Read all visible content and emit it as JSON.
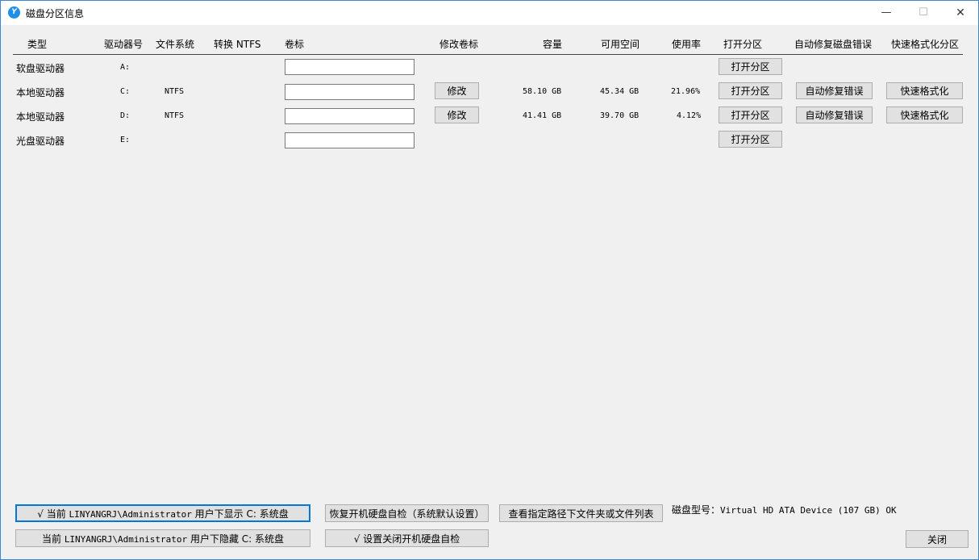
{
  "window": {
    "title": "磁盘分区信息",
    "app_icon_text": "Y",
    "min_glyph": "—",
    "max_glyph": "☐",
    "close_glyph": "✕"
  },
  "headers": {
    "type": "类型",
    "drive_letter": "驱动器号",
    "filesystem": "文件系统",
    "convert_ntfs": "转换 NTFS",
    "volume_label": "卷标",
    "modify_label": "修改卷标",
    "capacity": "容量",
    "free_space": "可用空间",
    "usage": "使用率",
    "open_partition": "打开分区",
    "auto_repair": "自动修复磁盘错误",
    "quick_format": "快速格式化分区"
  },
  "rows": [
    {
      "type": "软盘驱动器",
      "drive": "A:",
      "fs": "",
      "capacity": "",
      "free": "",
      "usage": "",
      "has_modify": false,
      "open_label": "打开分区",
      "repair_label": "",
      "format_label": ""
    },
    {
      "type": "本地驱动器",
      "drive": "C:",
      "fs": "NTFS",
      "capacity": "58.10 GB",
      "free": "45.34 GB",
      "usage": "21.96%",
      "has_modify": true,
      "modify_label": "修改",
      "open_label": "打开分区",
      "repair_label": "自动修复错误",
      "format_label": "快速格式化"
    },
    {
      "type": "本地驱动器",
      "drive": "D:",
      "fs": "NTFS",
      "capacity": "41.41 GB",
      "free": "39.70 GB",
      "usage": "4.12%",
      "has_modify": true,
      "modify_label": "修改",
      "open_label": "打开分区",
      "repair_label": "自动修复错误",
      "format_label": "快速格式化"
    },
    {
      "type": "光盘驱动器",
      "drive": "E:",
      "fs": "",
      "capacity": "",
      "free": "",
      "usage": "",
      "has_modify": false,
      "open_label": "打开分区",
      "repair_label": "",
      "format_label": ""
    }
  ],
  "bottom": {
    "show_c_prefix": "√ 当前 ",
    "show_c_user": "LINYANGRJ\\Administrator",
    "show_c_suffix": " 用户下显示 C: 系统盘",
    "hide_c_prefix": "当前 ",
    "hide_c_user": "LINYANGRJ\\Administrator",
    "hide_c_suffix": " 用户下隐藏 C: 系统盘",
    "restore_check": "恢复开机硬盘自检（系统默认设置）",
    "disable_check": "√ 设置关闭开机硬盘自检",
    "view_list": "查看指定路径下文件夹或文件列表",
    "disk_model_label": "磁盘型号：",
    "disk_model_value": "Virtual HD ATA Device (107 GB) OK",
    "close": "关闭"
  }
}
